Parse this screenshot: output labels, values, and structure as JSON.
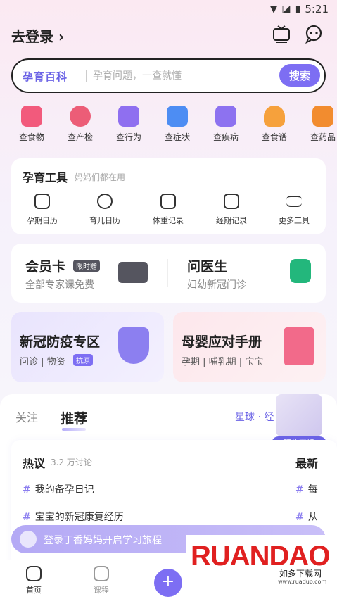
{
  "status_bar": {
    "time": "5:21"
  },
  "header": {
    "login_text": "去登录",
    "live_icon": "live-tv-icon",
    "chat_icon": "chat-bubble-icon"
  },
  "search": {
    "brand": "孕育百科",
    "placeholder": "孕育问题，一查就懂",
    "button": "搜索"
  },
  "quick_actions": [
    {
      "label": "查食物",
      "color": "#f25a7c"
    },
    {
      "label": "查产检",
      "color": "#ec5d77"
    },
    {
      "label": "查行为",
      "color": "#8f6ff0"
    },
    {
      "label": "查症状",
      "color": "#4d8df3"
    },
    {
      "label": "查疾病",
      "color": "#8d72f0"
    },
    {
      "label": "查食谱",
      "color": "#f6a13c"
    },
    {
      "label": "查药品",
      "color": "#f28c2f"
    }
  ],
  "tools": {
    "title": "孕育工具",
    "subtitle": "妈妈们都在用",
    "items": [
      {
        "label": "孕期日历",
        "icon": "heart-calendar-icon"
      },
      {
        "label": "育儿日历",
        "icon": "baby-face-icon"
      },
      {
        "label": "体重记录",
        "icon": "scale-icon"
      },
      {
        "label": "经期记录",
        "icon": "calendar-icon"
      },
      {
        "label": "更多工具",
        "icon": "menu-icon"
      }
    ]
  },
  "member": {
    "title": "会员卡",
    "badge": "限时赠",
    "subtitle": "全部专家课免费"
  },
  "doctor": {
    "title": "问医生",
    "subtitle": "妇幼新冠门诊"
  },
  "covid": {
    "title": "新冠防疫专区",
    "sub1": "问诊 | 物资",
    "badge": "抗原"
  },
  "manual": {
    "title": "母婴应对手册",
    "subtitle": "孕期 | 哺乳期 | 宝宝"
  },
  "feed_tabs": {
    "follow": "关注",
    "recommend": "推荐",
    "planet": "星球 · 经"
  },
  "live_promo": {
    "button": "预约直播"
  },
  "hot": {
    "title": "热议",
    "count": "3.2 万讨论",
    "latest": "最新",
    "topics": [
      "我的备孕日记",
      "宝宝的新冠康复经历"
    ],
    "right_topics": [
      "每",
      "从"
    ]
  },
  "login_banner": {
    "text": "登录丁香妈妈开启学习旅程"
  },
  "nav": {
    "home": "首页",
    "course": "课程"
  },
  "watermark": {
    "brand": "RUANDAO",
    "cn": "如多下载网",
    "url": "www.ruaduo.com"
  }
}
